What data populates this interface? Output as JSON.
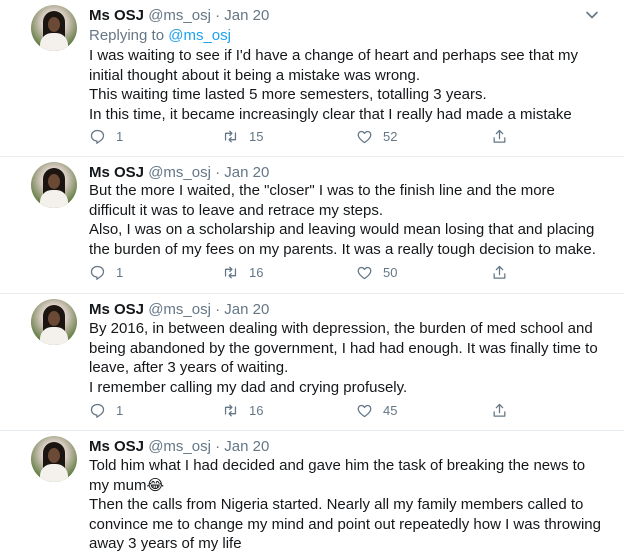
{
  "tweets": [
    {
      "name": "Ms OSJ",
      "handle": "@ms_osj",
      "sep": "·",
      "date": "Jan 20",
      "replying_prefix": "Replying to ",
      "replying_to": "@ms_osj",
      "lines": [
        "I was waiting to see if I'd have a change of heart and perhaps see that my initial thought about it being a mistake was wrong.",
        "This waiting time lasted 5 more semesters, totalling 3 years.",
        "In this time, it became increasingly clear that I really had made a mistake"
      ],
      "replies": "1",
      "retweets": "15",
      "likes": "52"
    },
    {
      "name": "Ms OSJ",
      "handle": "@ms_osj",
      "sep": "·",
      "date": "Jan 20",
      "lines": [
        "But the more I waited, the \"closer\" I was to the finish line and the more difficult it was to leave and retrace my steps.",
        "Also, I was on a scholarship and leaving would mean losing that and placing the burden of my fees on my parents. It was a really tough decision to make."
      ],
      "replies": "1",
      "retweets": "16",
      "likes": "50"
    },
    {
      "name": "Ms OSJ",
      "handle": "@ms_osj",
      "sep": "·",
      "date": "Jan 20",
      "lines": [
        "By 2016, in between dealing with depression, the burden of med school and being abandoned by the government,  I had had enough. It was finally time to leave, after 3 years of waiting.",
        "I remember calling my dad and crying profusely."
      ],
      "replies": "1",
      "retweets": "16",
      "likes": "45"
    },
    {
      "name": "Ms OSJ",
      "handle": "@ms_osj",
      "sep": "·",
      "date": "Jan 20",
      "lines": [
        "Told him what I had decided and gave him the task of breaking the news to my mum😂",
        "Then the calls from Nigeria started. Nearly all my family members called to convince me to change my mind and point out repeatedly how I was throwing away 3 years of my life"
      ]
    }
  ],
  "colors": {
    "text": "#14171a",
    "secondary": "#657786",
    "link": "#1da1f2",
    "divider": "#e6ecf0"
  },
  "icons": [
    "reply-icon",
    "retweet-icon",
    "like-icon",
    "share-icon",
    "caret-down-icon"
  ]
}
